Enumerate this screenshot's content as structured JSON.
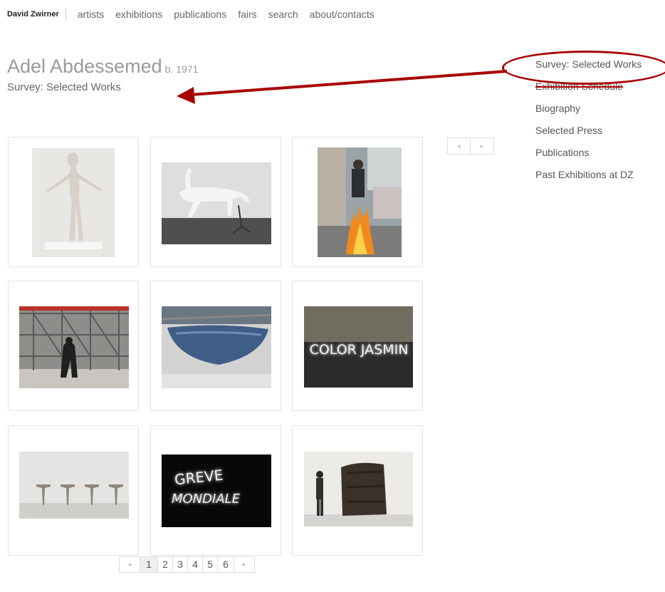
{
  "topnav": {
    "brand": "David Zwirner",
    "links": [
      "artists",
      "exhibitions",
      "publications",
      "fairs",
      "search",
      "about/contacts"
    ]
  },
  "artist": {
    "name": "Adel Abdessemed",
    "born": "b. 1971"
  },
  "section_title": "Survey: Selected Works",
  "sidebar": {
    "items": [
      "Survey: Selected Works",
      "Exhibition Schedule",
      "Biography",
      "Selected Press",
      "Publications",
      "Past Exhibitions at DZ"
    ]
  },
  "mini_pager": {
    "prev": "◂",
    "next": "▸"
  },
  "artworks": [
    {
      "icon": "white-figure-sculpture"
    },
    {
      "icon": "white-horse-sculpture"
    },
    {
      "icon": "man-on-fire-street-photo"
    },
    {
      "icon": "figures-in-scaffolding"
    },
    {
      "icon": "suspended-blue-boat"
    },
    {
      "icon": "color-jasmin-neon-text",
      "text": "COLOR JASMIN"
    },
    {
      "icon": "four-crucifix-figures"
    },
    {
      "icon": "greve-mondiale-neon-text",
      "text_line1": "GREVE",
      "text_line2": "MONDIALE"
    },
    {
      "icon": "dark-cube-with-man"
    }
  ],
  "pager": {
    "prev": "◂",
    "pages": [
      "1",
      "2",
      "3",
      "4",
      "5",
      "6"
    ],
    "current": "1",
    "next": "▸"
  },
  "colors": {
    "annotation": "#a80000",
    "text": "#555555",
    "title": "#9a9a9a"
  }
}
